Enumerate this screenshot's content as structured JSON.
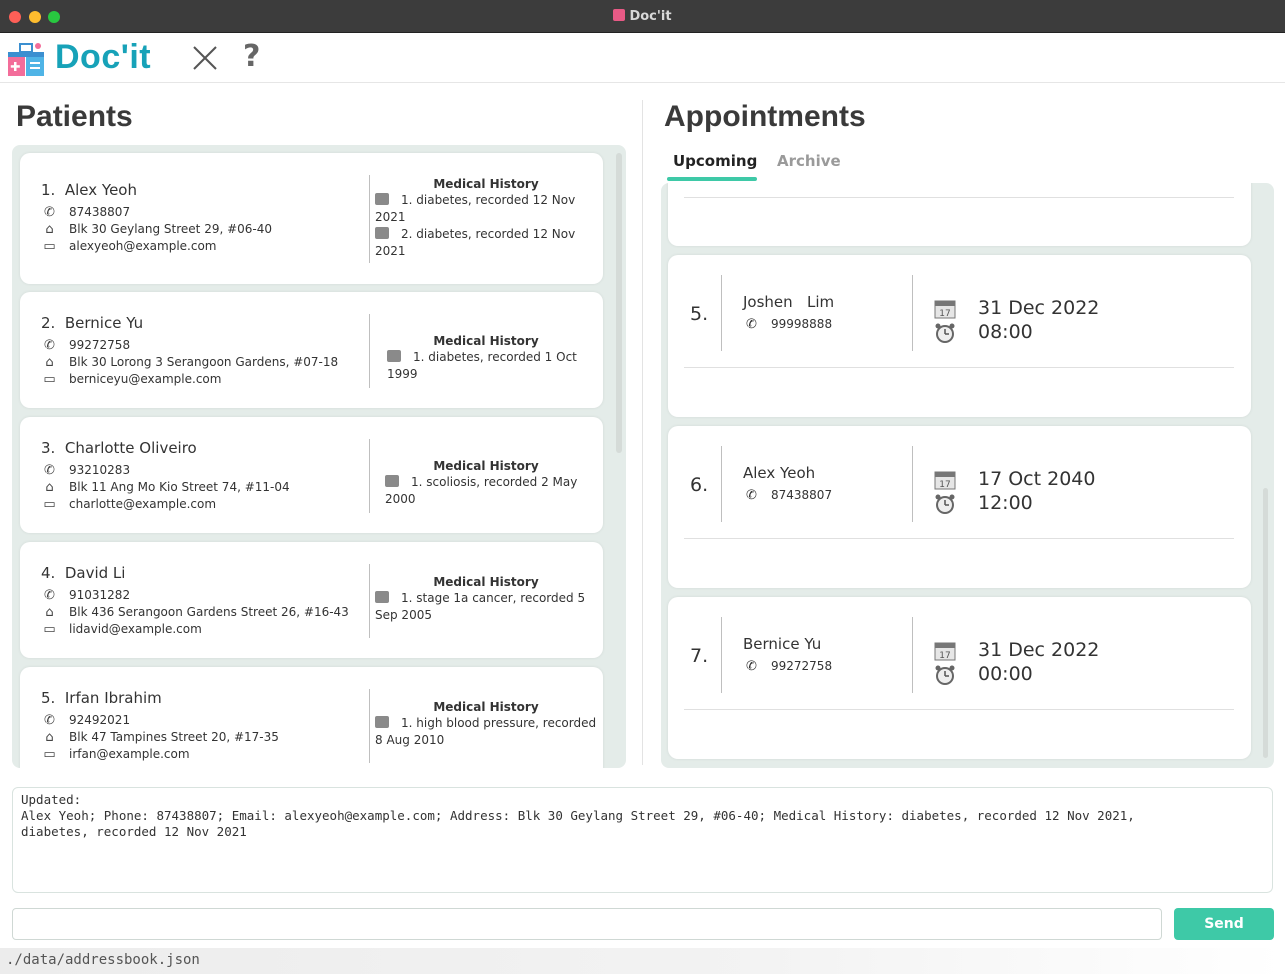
{
  "window": {
    "title": "Doc'it"
  },
  "toolbar": {
    "app_name": "Doc'it",
    "help_label": "?"
  },
  "patients": {
    "heading": "Patients",
    "medical_history_label": "Medical History",
    "items": [
      {
        "index": "1.",
        "name": "Alex Yeoh",
        "phone": "87438807",
        "address": "Blk 30 Geylang Street 29, #06-40",
        "email": "alexyeoh@example.com",
        "history": [
          "1. diabetes, recorded 12 Nov 2021",
          "2. diabetes, recorded 12 Nov 2021"
        ]
      },
      {
        "index": "2.",
        "name": "Bernice Yu",
        "phone": "99272758",
        "address": "Blk 30 Lorong 3 Serangoon Gardens, #07-18",
        "email": "berniceyu@example.com",
        "history": [
          "1. diabetes, recorded 1 Oct 1999"
        ]
      },
      {
        "index": "3.",
        "name": "Charlotte Oliveiro",
        "phone": "93210283",
        "address": "Blk 11 Ang Mo Kio Street 74, #11-04",
        "email": "charlotte@example.com",
        "history": [
          "1. scoliosis, recorded 2 May 2000"
        ]
      },
      {
        "index": "4.",
        "name": "David Li",
        "phone": "91031282",
        "address": "Blk 436 Serangoon Gardens Street 26, #16-43",
        "email": "lidavid@example.com",
        "history": [
          "1. stage 1a cancer, recorded 5 Sep 2005"
        ]
      },
      {
        "index": "5.",
        "name": "Irfan Ibrahim",
        "phone": "92492021",
        "address": "Blk 47 Tampines Street 20, #17-35",
        "email": "irfan@example.com",
        "history": [
          "1. high blood pressure, recorded 8 Aug 2010"
        ]
      }
    ]
  },
  "appointments": {
    "heading": "Appointments",
    "tabs": [
      {
        "label": "Upcoming"
      },
      {
        "label": "Archive"
      }
    ],
    "items": [
      {
        "index": "5.",
        "name": "Joshen   Lim",
        "phone": "99998888",
        "date": "31 Dec 2022",
        "time": "08:00"
      },
      {
        "index": "6.",
        "name": "Alex Yeoh",
        "phone": "87438807",
        "date": "17 Oct 2040",
        "time": "12:00"
      },
      {
        "index": "7.",
        "name": "Bernice Yu",
        "phone": "99272758",
        "date": "31 Dec 2022",
        "time": "00:00"
      }
    ]
  },
  "result": {
    "text": "Updated:\nAlex Yeoh; Phone: 87438807; Email: alexyeoh@example.com; Address: Blk 30 Geylang Street 29, #06-40; Medical History: diabetes, recorded 12 Nov 2021,\ndiabetes, recorded 12 Nov 2021"
  },
  "command": {
    "value": "",
    "send_label": "Send"
  },
  "status": {
    "file_path": "./data/addressbook.json"
  },
  "colors": {
    "accent": "#3ec9a7",
    "brand": "#17a2b8",
    "list_bg": "#e4ece9"
  },
  "icons": {
    "phone": "phone-icon",
    "address": "house-icon",
    "email": "email-icon",
    "history": "medical-record-icon",
    "date": "calendar-icon",
    "time": "alarm-clock-icon"
  }
}
